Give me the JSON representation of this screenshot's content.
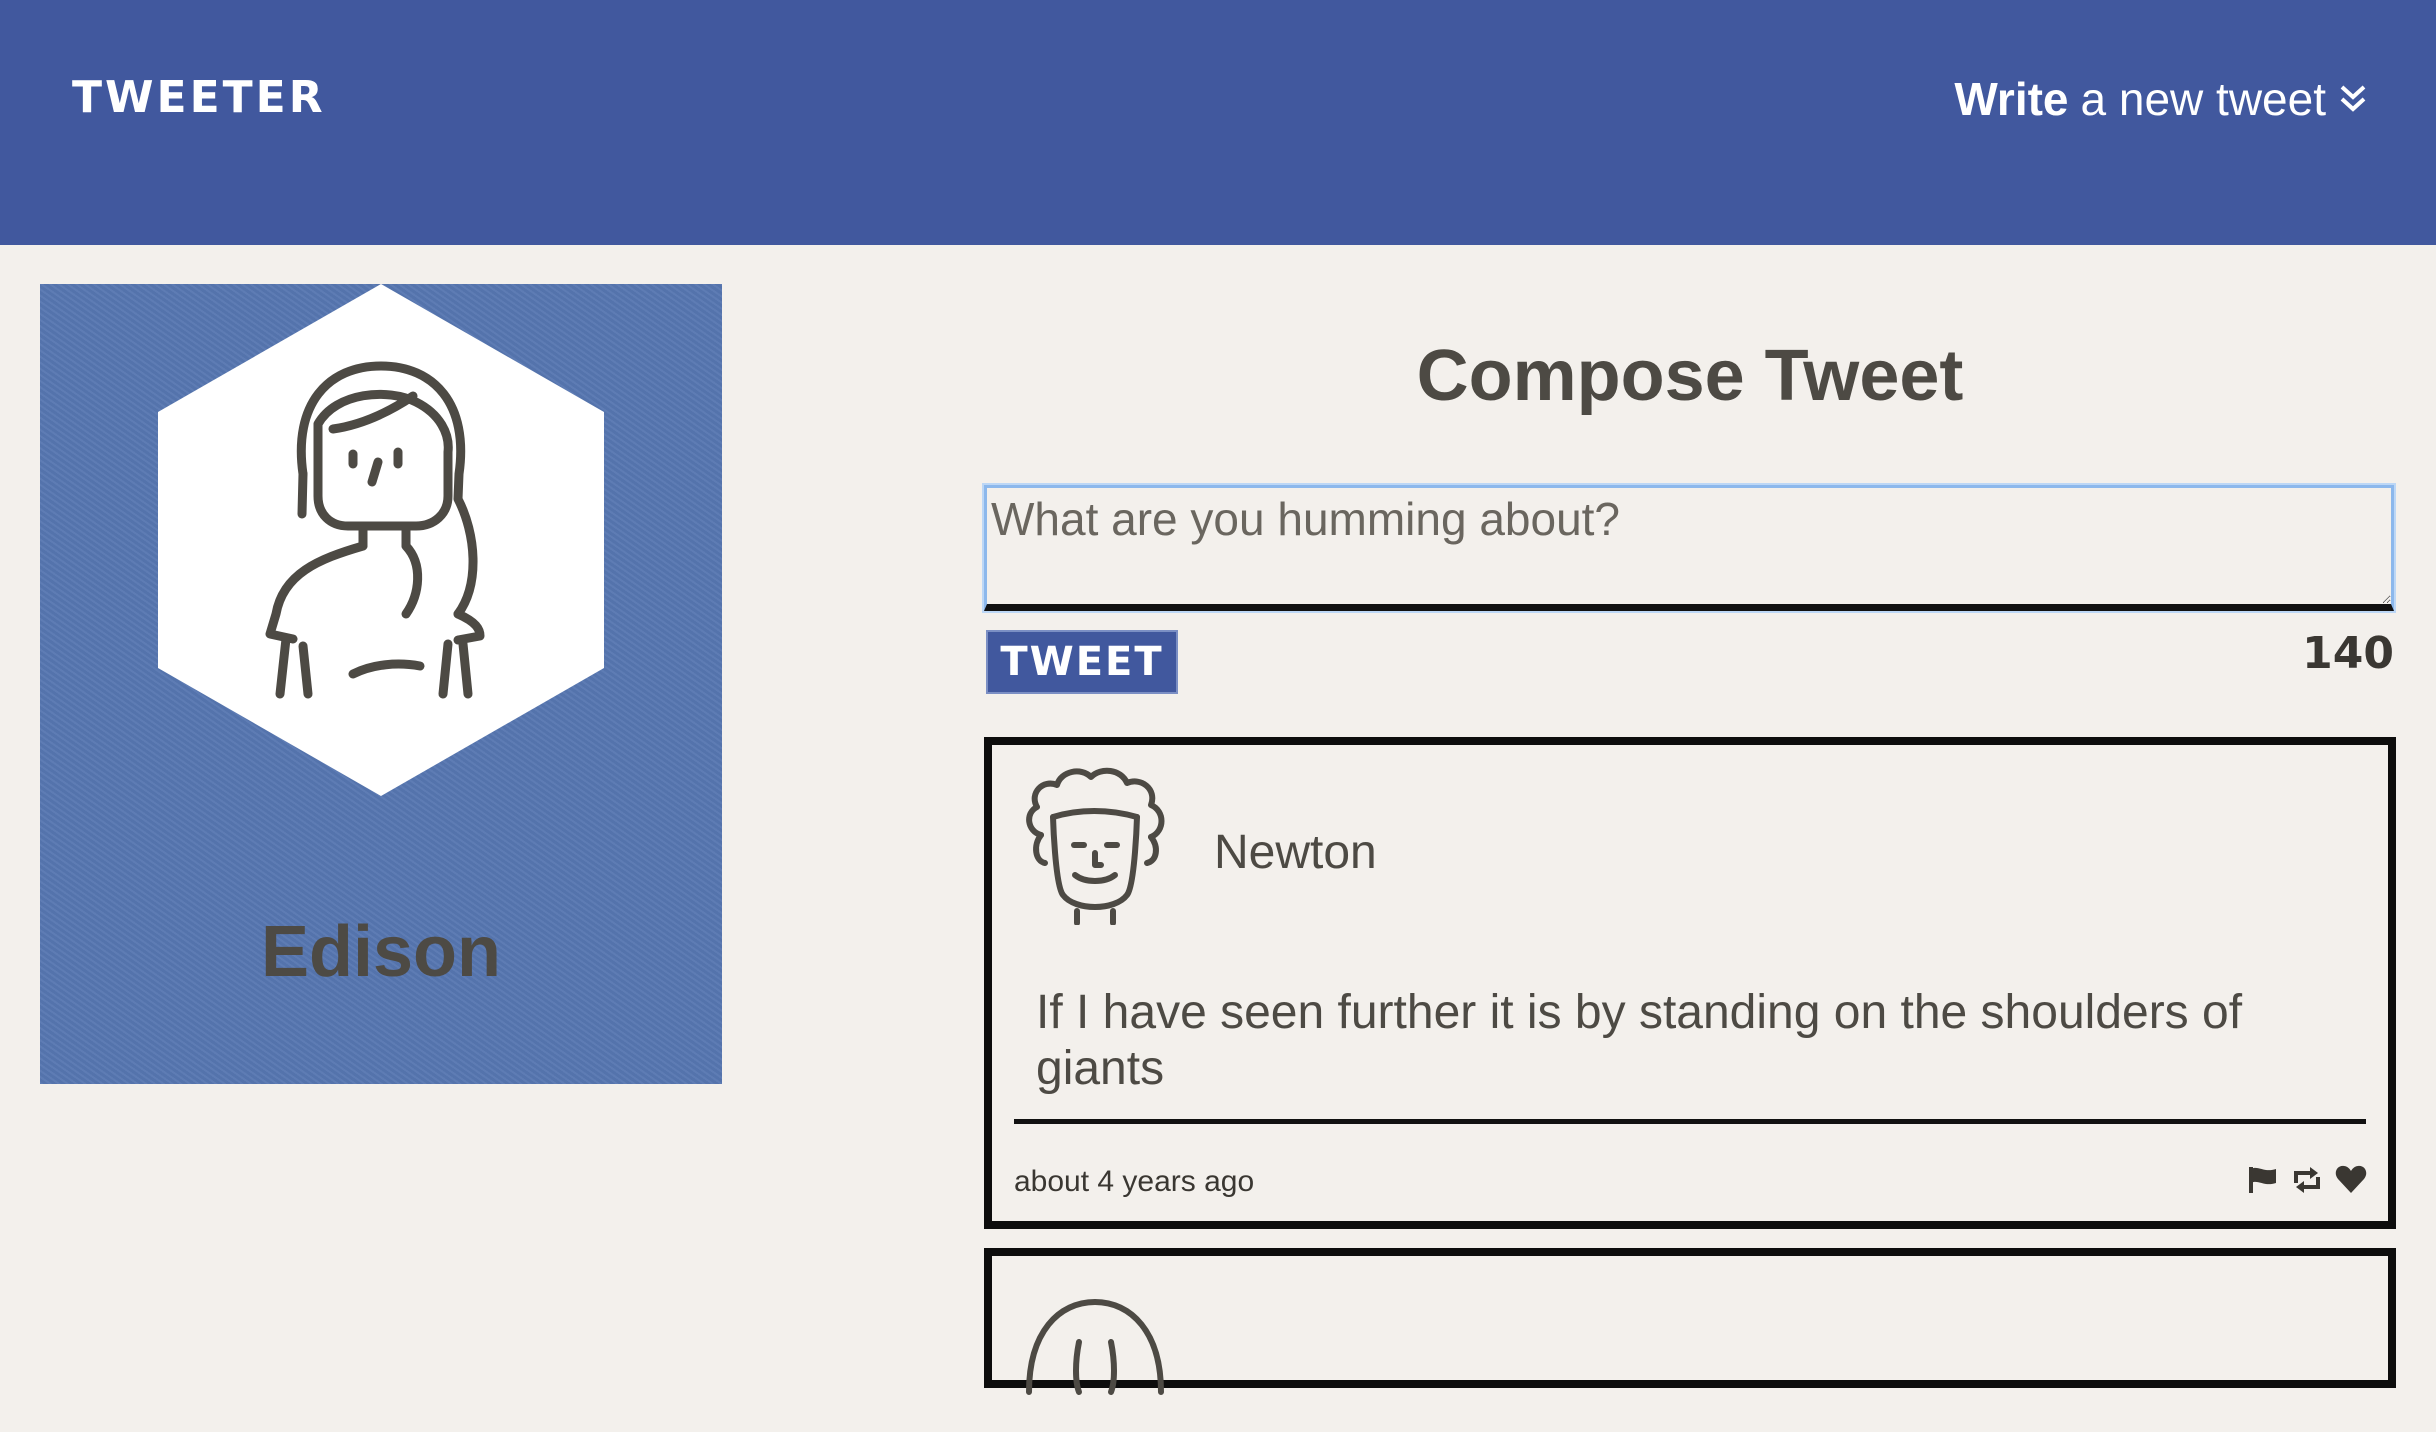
{
  "nav": {
    "brand": "TWEETER",
    "compose_bold": "Write",
    "compose_rest": "a new tweet",
    "compose_icon": "double-chevron-down-icon"
  },
  "colors": {
    "nav_bg": "#41589e",
    "page_bg": "#f3f0ec",
    "profile_bg": "#5777b1",
    "text": "#4d4a44",
    "focus": "#8cb8ec"
  },
  "profile": {
    "name": "Edison",
    "avatar_icon": "woman-avatar-icon"
  },
  "compose": {
    "title": "Compose Tweet",
    "placeholder": "What are you humming about?",
    "button_label": "TWEET",
    "counter": "140"
  },
  "tweets": [
    {
      "author": "Newton",
      "avatar_icon": "curly-hair-man-avatar-icon",
      "text": "If I have seen further it is by standing on the shoulders of giants",
      "time": "about 4 years ago",
      "actions": [
        "flag-icon",
        "retweet-icon",
        "heart-icon"
      ]
    }
  ]
}
